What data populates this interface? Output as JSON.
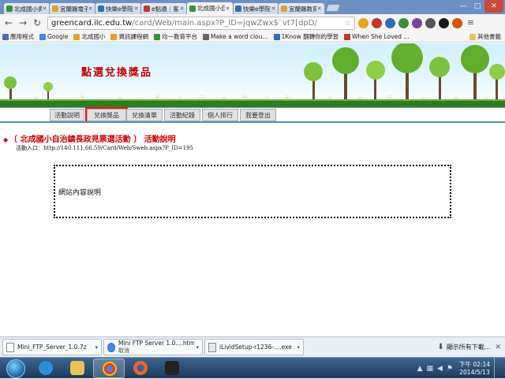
{
  "browser": {
    "tabs": [
      {
        "label": "北成國小資訊",
        "color": "#3a8f3a"
      },
      {
        "label": "宜蘭縣電子",
        "color": "#e0a030"
      },
      {
        "label": "快樂e學院",
        "color": "#2d6fb7"
      },
      {
        "label": "e點通｜客",
        "color": "#c0392b"
      },
      {
        "label": "北成國小自治",
        "color": "#3a8f3a"
      },
      {
        "label": "快樂e學院",
        "color": "#2d6fb7"
      },
      {
        "label": "宜蘭縣教育",
        "color": "#e0a030"
      }
    ],
    "active_tab_index": 4,
    "url_host": "greencard.ilc.edu.tw",
    "url_path": "/card/Web/main.aspx?P_ID=jqwZwx$`vt7[dpD/",
    "bookmarks": [
      {
        "label": "應用程式",
        "color": "#4d6fa8"
      },
      {
        "label": "Google",
        "color": "#4285f4"
      },
      {
        "label": "北成國小",
        "color": "#e0a030"
      },
      {
        "label": "資訊課程網",
        "color": "#e0a030"
      },
      {
        "label": "均一教育平台",
        "color": "#3a8f3a"
      },
      {
        "label": "Make a word clou...",
        "color": "#666666"
      },
      {
        "label": "1Know 翻轉你的學習",
        "color": "#2d6fb7"
      },
      {
        "label": "When She Loved ...",
        "color": "#c0392b"
      }
    ],
    "other_bookmarks": "其他書籤"
  },
  "page": {
    "banner_title": "點選兌換獎品",
    "nav_tabs": [
      {
        "label": "活動說明"
      },
      {
        "label": "兌換獎品",
        "highlighted": true
      },
      {
        "label": "兌換清單"
      },
      {
        "label": "活動紀錄"
      },
      {
        "label": "個人排行"
      },
      {
        "label": "我要登出"
      }
    ],
    "heading": "〔 北成國小自治鎮長政見票選活動 〕 活動說明",
    "entry_label": "活動入口：",
    "entry_url": "http://140.111.66.59/Card/Web/Sweb.aspx?P_ID=195",
    "content_text": "網站內容說明"
  },
  "downloads": {
    "items": [
      {
        "name": "Mini_FTP_Server_1.0.7z",
        "sub": ""
      },
      {
        "name": "Mini FTP Server 1.0....htm",
        "sub": "取消"
      },
      {
        "name": "iLividSetup-r1236-....exe",
        "sub": ""
      }
    ],
    "show_all": "顯示所有下載..."
  },
  "taskbar": {
    "time": "下午 02:14",
    "date": "2014/5/13"
  }
}
